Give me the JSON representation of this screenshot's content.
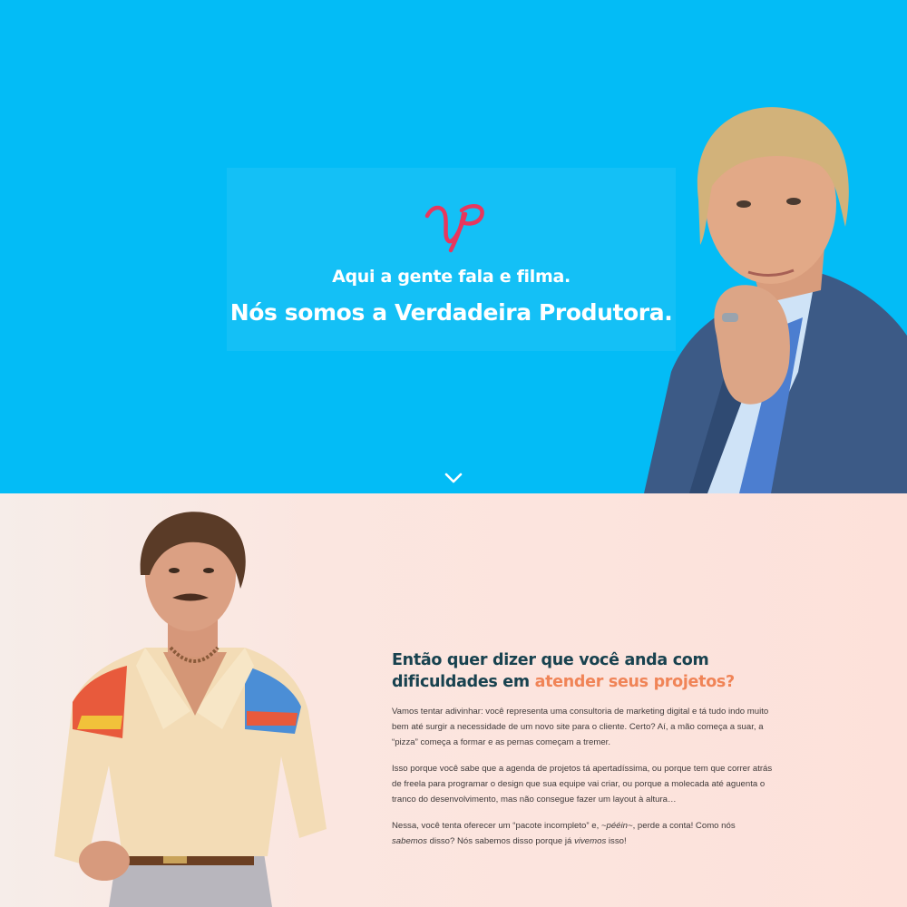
{
  "hero": {
    "tagline": "Aqui a gente fala e filma.",
    "headline": "Nós somos a Verdadeira Produtora.",
    "background_color": "#03bcf6",
    "logo_color": "#e8375d",
    "scroll_icon": "chevron-down-icon"
  },
  "section": {
    "heading_part1": "Então quer dizer que você anda com dificuldades em ",
    "heading_accent": "atender seus projetos?",
    "accent_color": "#f08457",
    "heading_color": "#18424f",
    "p1": "Vamos tentar adivinhar: você representa uma consultoria de marketing digital e tá tudo indo muito bem até surgir a necessidade de um novo site para o cliente. Certo? Aí, a mão começa a suar, a “pizza” começa a formar e as pernas começam a tremer.",
    "p2": "Isso porque você sabe que a agenda de projetos tá apertadíssima, ou porque tem que correr atrás de freela para programar o design que sua equipe vai criar, ou porque a molecada até aguenta o tranco do desenvolvimento, mas não consegue fazer um layout à altura…",
    "p3_a": "Nessa, você tenta oferecer um “pacote incompleto” e, ",
    "p3_b": "~pééin~",
    "p3_c": ", perde a conta! Como nós ",
    "p3_d": "sabemos",
    "p3_e": " disso? Nós sabemos disso porque já ",
    "p3_f": "vivemos",
    "p3_g": " isso!"
  }
}
